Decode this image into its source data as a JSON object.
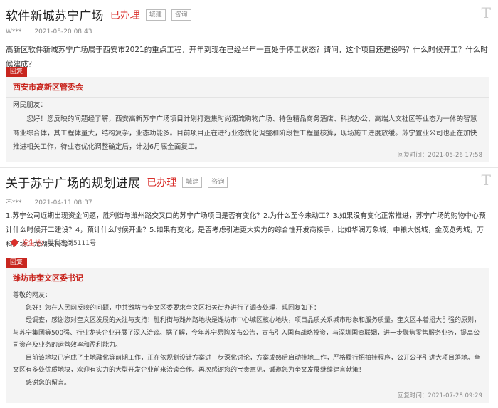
{
  "posts": [
    {
      "title": "软件新城苏宁广场",
      "status": "已办理",
      "tags": [
        "城建",
        "咨询"
      ],
      "corner_icon": "T",
      "author": "W***",
      "time": "2021-05-20 08:43",
      "question": "高新区软件新城苏宁广场属于西安市2021的重点工程，开年到现在已经半年一直处于停工状态？请问，这个项目还建设吗？什么时候开工？什么时候建成？",
      "reply_badge": "回复",
      "reply": {
        "org": "西安市高新区管委会",
        "paragraphs": [
          "网民朋友：",
          "　　您好！您反映的问题经了解，西安高新苏宁广场项目计划打造集时尚潮流购物广场、特色精品商务酒店、科技办公、高端人文社区等业态为一体的智慧商业综合体，其工程体量大，结构复杂，业态功能多。目前项目正在进行业态优化调整和阶段性工程量核算，现场施工进度放缓。苏宁置业公司也正在加快推进相关工作，待业态优化调整确定后，计划6月底全面复工。"
        ],
        "time": "回复时间：2021-05-26 17:58"
      }
    },
    {
      "title": "关于苏宁广场的规划进展",
      "status": "已办理",
      "tags": [
        "城建",
        "咨询"
      ],
      "corner_icon": "T",
      "author": "不***",
      "time": "2021-04-11 08:37",
      "question": "1.苏宁公司近期出现资金问题，胜利街与潍州路交叉口的苏宁广场项目是否有变化？2.为什么至今未动工？3.如果没有变化正常推进，苏宁广场的购物中心预计什么时候开工建设？4，预计什么时候开业？5.如果有变化，是否考虑引进更大实力的综合性开发商接手，比如华润万象城，中粮大悦城，金茂览秀城，万科广场，龙湖天街等？",
      "location_label": "发生地:",
      "location": "胜利东街5111号",
      "reply_badge": "回复",
      "reply": {
        "org": "潍坊市奎文区委书记",
        "paragraphs": [
          "尊敬的网友：",
          "　　您好！您在人民网反映的问题，中共潍坊市奎文区委要求奎文区相关街办进行了调查处理，现回复如下：",
          "　　经调查，感谢您对奎文区发展的关注与支持！胜利街与潍州路地块是潍坊市中心城区核心地块，项目品质关系城市形象和服务质量。奎文区本着招大引强的原则，与苏宁集团等500强、行业龙头企业开展了深入洽谈。据了解，今年苏宁易购发布公告，宣布引入国有战略投资，与深圳国资联姻，进一步聚焦零售服务业务，提高公司资产及业务的运营效率和盈利能力。",
          "　　目前该地块已完成了土地融化等前期工作，正在依规划设计方案进一步深化讨论，方案成熟后启动挂地工作，严格履行招拍挂程序，公开公平引进大项目落地。奎文区有多处优质地块，欢迎有实力的大型开发企业前来洽谈合作。再次感谢您的宝贵意见，诚邀您为奎文发展继续建言献策！",
          "　　感谢您的留言。"
        ],
        "time": "回复时间：2021-07-28 09:29"
      }
    }
  ]
}
